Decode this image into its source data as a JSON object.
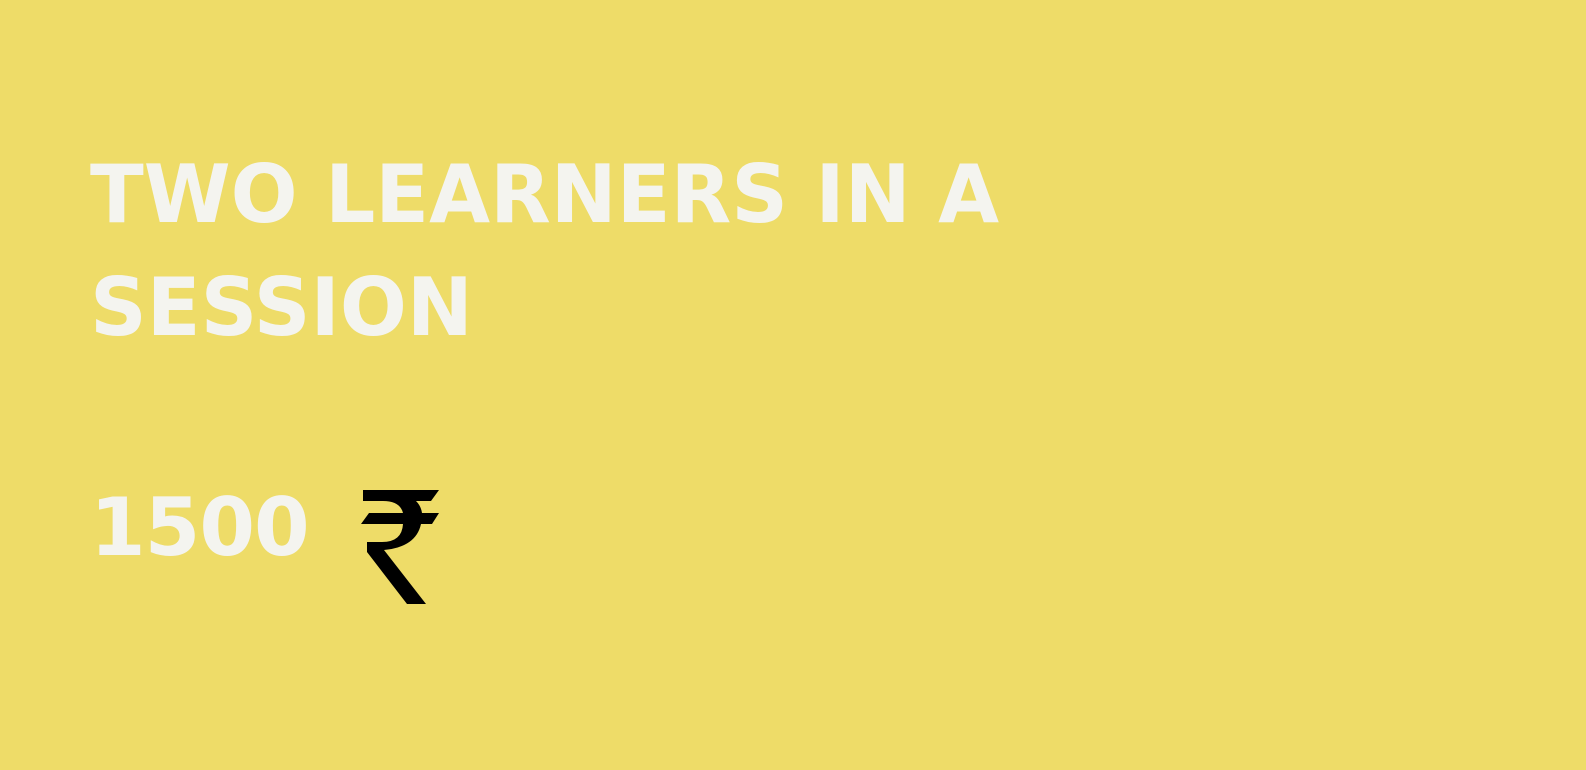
{
  "plan": {
    "title": "TWO LEARNERS IN A SESSION",
    "price": "1500",
    "currency_icon": "rupee-icon"
  },
  "colors": {
    "background": "#eedc68",
    "text": "#f4f4ef",
    "currency_symbol": "#000000"
  }
}
